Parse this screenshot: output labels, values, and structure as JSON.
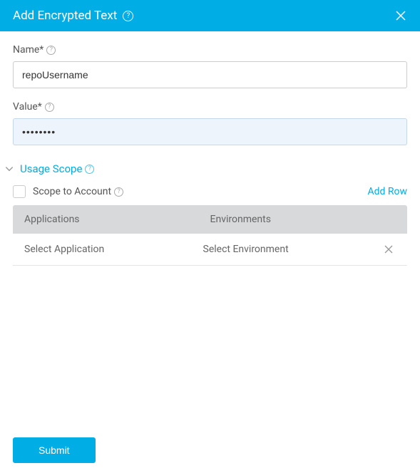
{
  "header": {
    "title": "Add Encrypted Text"
  },
  "form": {
    "name_label": "Name*",
    "name_value": "repoUsername",
    "value_label": "Value*",
    "value_value": "••••••••"
  },
  "usage_scope": {
    "title": "Usage Scope",
    "scope_to_account_label": "Scope to Account",
    "add_row_label": "Add Row",
    "columns": {
      "applications": "Applications",
      "environments": "Environments"
    },
    "rows": [
      {
        "application": "Select Application",
        "environment": "Select Environment"
      }
    ]
  },
  "footer": {
    "submit_label": "Submit"
  }
}
